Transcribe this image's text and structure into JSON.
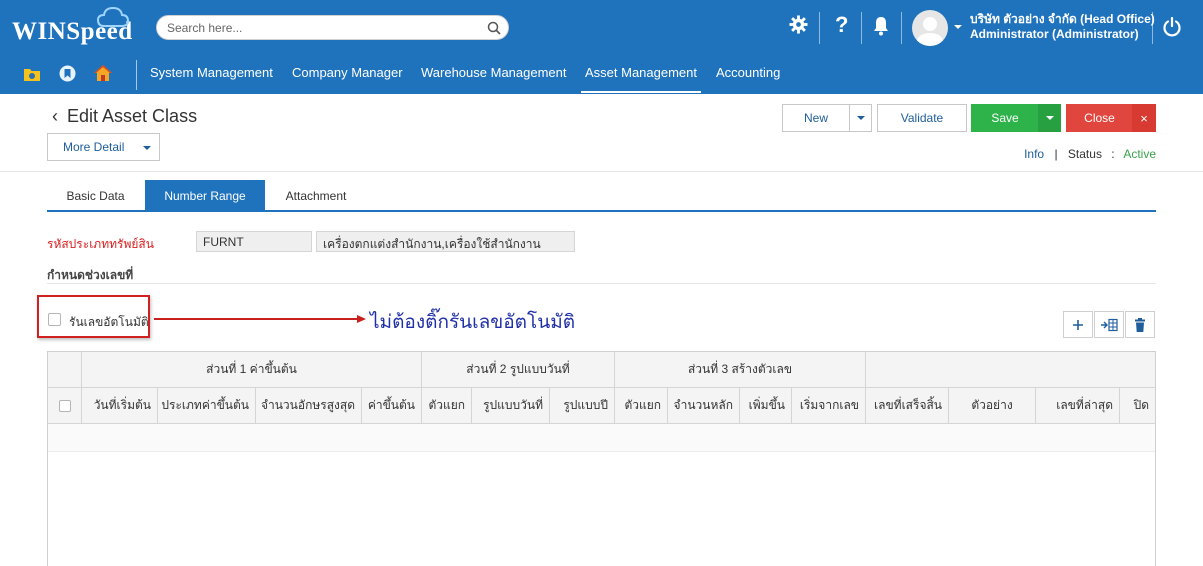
{
  "app": {
    "logo": "WINSpeed"
  },
  "search": {
    "placeholder": "Search here..."
  },
  "user": {
    "company": "บริษัท ตัวอย่าง จำกัด (Head Office)",
    "role": "Administrator (Administrator)"
  },
  "nav": {
    "items": [
      "System Management",
      "Company Manager",
      "Warehouse Management",
      "Asset Management",
      "Accounting"
    ],
    "active": "Asset Management"
  },
  "page": {
    "title": "Edit Asset Class",
    "more_detail": "More Detail"
  },
  "toolbar": {
    "new": "New",
    "validate": "Validate",
    "save": "Save",
    "close": "Close",
    "close_x": "×"
  },
  "status": {
    "info": "Info",
    "sep": "|",
    "label": "Status",
    "colon": ":",
    "value": "Active"
  },
  "tabs": [
    "Basic Data",
    "Number Range",
    "Attachment"
  ],
  "form": {
    "asset_type_label": "รหัสประเภททรัพย์สิน",
    "asset_type_code": "FURNT",
    "asset_type_name": "เครื่องตกแต่งสำนักงาน,เครื่องใช้สำนักงาน",
    "section_label": "กำหนดช่วงเลขที่",
    "auto_number_label": "รันเลขอัตโนมัติ"
  },
  "annotation": {
    "text": "ไม่ต้องติ๊กรันเลขอัตโนมัติ"
  },
  "grid": {
    "groups": [
      "ส่วนที่ 1 ค่าขึ้นต้น",
      "ส่วนที่ 2 รูปแบบวันที่",
      "ส่วนที่ 3 สร้างตัวเลข"
    ],
    "columns": [
      "วันที่เริ่มต้น",
      "ประเภทค่าขึ้นต้น",
      "จำนวนอักษรสูงสุด",
      "ค่าขึ้นต้น",
      "ตัวแยก",
      "รูปแบบวันที่",
      "รูปแบบปี",
      "ตัวแยก",
      "จำนวนหลัก",
      "เพิ่มขึ้น",
      "เริ่มจากเลข",
      "เลขที่เสร็จสิ้น",
      "ตัวอย่าง",
      "เลขที่ล่าสุด",
      "ปิด"
    ]
  },
  "colors": {
    "brand": "#1f73bd",
    "save": "#2db34a",
    "close": "#e0463d",
    "required": "#d62020",
    "annotation": "#1f2fa8"
  },
  "icons": [
    "settings-gear-icon",
    "help-icon",
    "bell-icon",
    "power-icon",
    "folder-icon",
    "bookmark-icon",
    "home-icon",
    "plus-icon",
    "insert-row-icon",
    "trash-icon",
    "search-icon"
  ]
}
